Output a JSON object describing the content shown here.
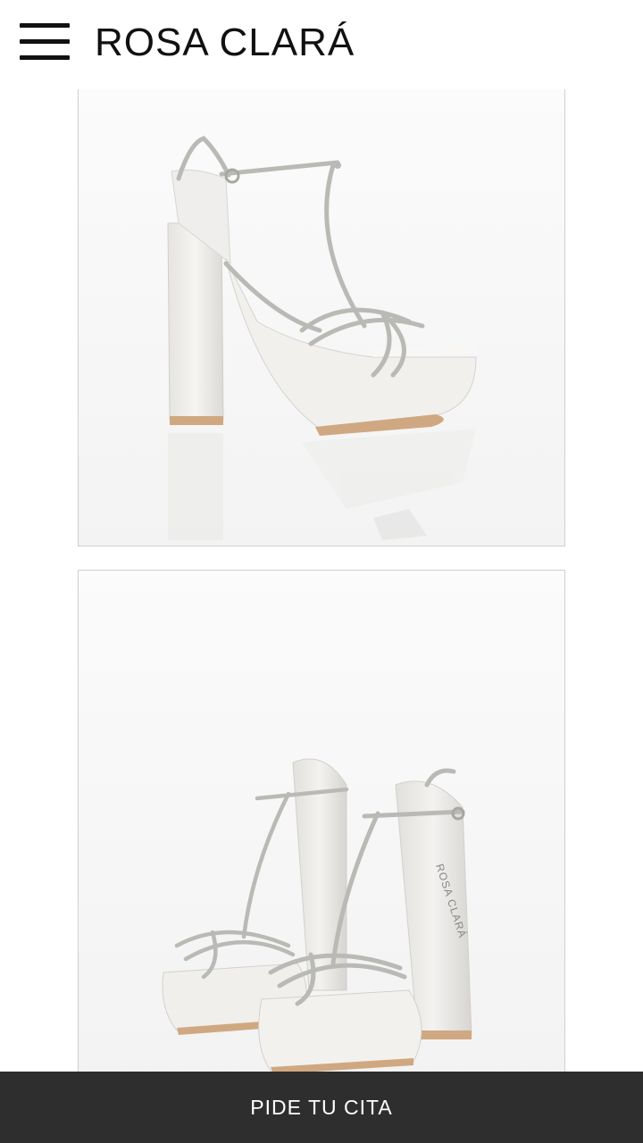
{
  "header": {
    "menu_icon": "hamburger-menu-icon",
    "brand": "ROSA CLARÁ"
  },
  "products": [
    {
      "image": "bridal-platform-sandal-side-view"
    },
    {
      "image": "bridal-platform-sandal-pair-view",
      "imprint": "ROSA CLARÁ"
    }
  ],
  "cta": {
    "label": "PIDE TU CITA"
  },
  "colors": {
    "cta_background": "#2e2e2e",
    "cta_text": "#ffffff",
    "brand_text": "#111111",
    "shoe_white": "#f1efec",
    "strap_silver": "#b9bab5"
  }
}
